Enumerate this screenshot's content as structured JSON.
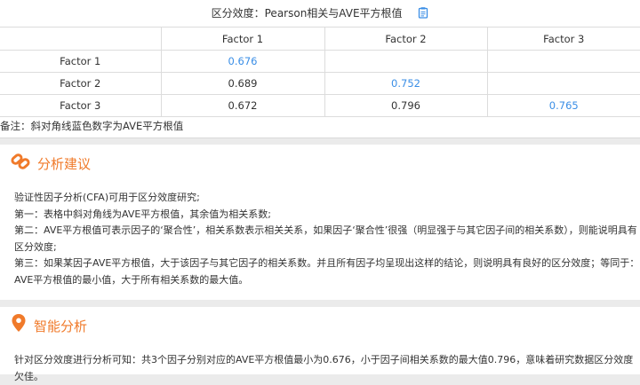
{
  "table": {
    "title": "区分效度：Pearson相关与AVE平方根值",
    "headers": [
      "",
      "Factor 1",
      "Factor 2",
      "Factor 3"
    ],
    "rows": [
      {
        "label": "Factor 1",
        "c1": "0.676",
        "c2": "",
        "c3": ""
      },
      {
        "label": "Factor 2",
        "c1": "0.689",
        "c2": "0.752",
        "c3": ""
      },
      {
        "label": "Factor 3",
        "c1": "0.672",
        "c2": "0.796",
        "c3": "0.765"
      }
    ],
    "note": "备注：斜对角线蓝色数字为AVE平方根值"
  },
  "advice": {
    "title": "分析建议",
    "lines": [
      "验证性因子分析(CFA)可用于区分效度研究;",
      "第一：表格中斜对角线为AVE平方根值，其余值为相关系数;",
      "第二：AVE平方根值可表示因子的‘聚合性’，相关系数表示相关关系，如果因子‘聚合性’很强（明显强于与其它因子间的相关系数），则能说明具有区分效度;",
      "第三：如果某因子AVE平方根值，大于该因子与其它因子的相关系数。并且所有因子均呈现出这样的结论，则说明具有良好的区分效度；等同于：AVE平方根值的最小值，大于所有相关系数的最大值。"
    ]
  },
  "smart": {
    "title": "智能分析",
    "text": "针对区分效度进行分析可知：共3个因子分别对应的AVE平方根值最小为0.676，小于因子间相关系数的最大值0.796，意味着研究数据区分效度欠佳。"
  },
  "colors": {
    "accent": "#f07a2a",
    "ave_blue": "#3a8ee6",
    "copy_icon": "#3a8ee6"
  },
  "icons": {
    "copy": "copy-icon",
    "link": "link-icon",
    "location": "location-pin-icon"
  }
}
